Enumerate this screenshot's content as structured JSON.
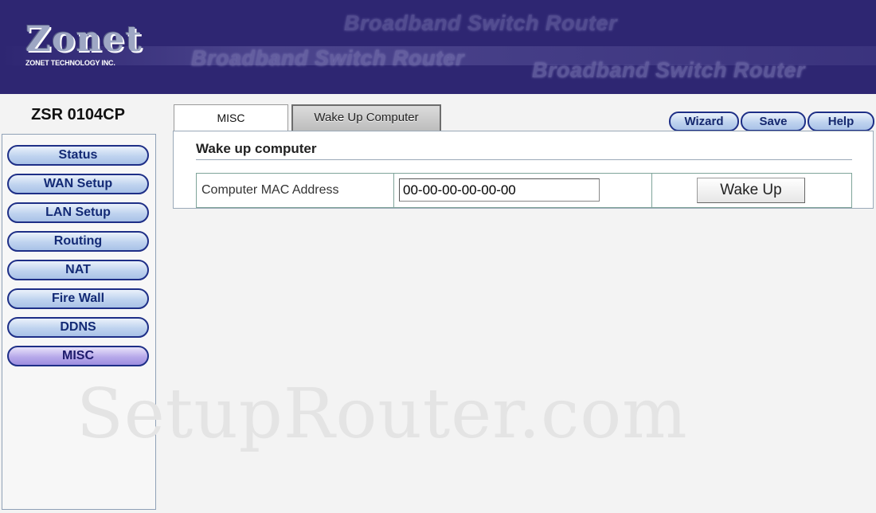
{
  "header": {
    "brand": "Zonet",
    "company": "ZONET TECHNOLOGY INC.",
    "banner_text": "Broadband Switch Router"
  },
  "sidebar": {
    "model": "ZSR 0104CP",
    "items": [
      {
        "label": "Status"
      },
      {
        "label": "WAN Setup"
      },
      {
        "label": "LAN Setup"
      },
      {
        "label": "Routing"
      },
      {
        "label": "NAT"
      },
      {
        "label": "Fire Wall"
      },
      {
        "label": "DDNS"
      },
      {
        "label": "MISC",
        "active": true
      }
    ]
  },
  "tabs": [
    {
      "label": "MISC"
    },
    {
      "label": "Wake Up Computer",
      "active": true
    }
  ],
  "toolbar": {
    "wizard": "Wizard",
    "save": "Save",
    "help": "Help"
  },
  "content": {
    "title": "Wake up computer",
    "mac_label": "Computer MAC Address",
    "mac_value": "00-00-00-00-00-00",
    "wake_button": "Wake Up"
  },
  "watermark": "SetupRouter.com",
  "colors": {
    "header_bg": "#2e2672",
    "nav_border": "#1e2f87",
    "active_nav": "#b7a9ea"
  }
}
